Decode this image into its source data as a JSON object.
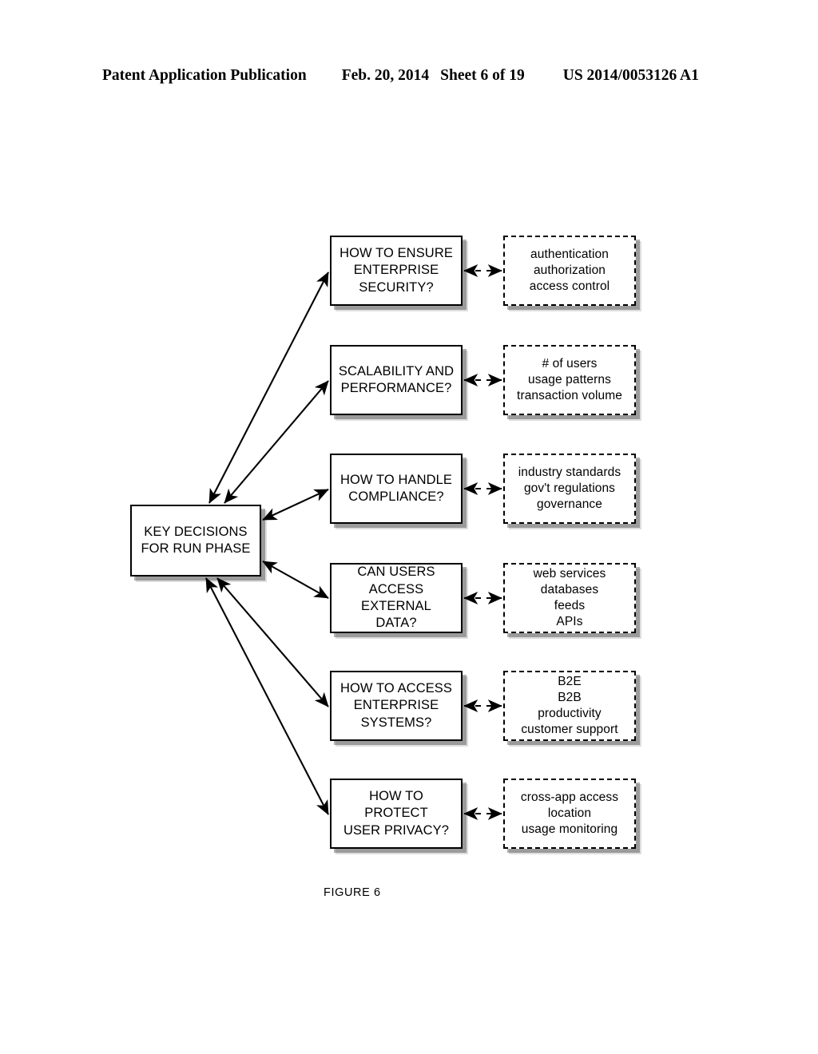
{
  "header": {
    "publication": "Patent Application Publication",
    "date": "Feb. 20, 2014",
    "sheet": "Sheet 6 of 19",
    "number": "US 2014/0053126 A1"
  },
  "figure": {
    "caption": "FIGURE 6",
    "hub": {
      "label": "KEY DECISIONS\nFOR RUN PHASE"
    },
    "rows": [
      {
        "decision": "HOW TO ENSURE\nENTERPRISE\nSECURITY?",
        "attributes": "authentication\nauthorization\naccess control"
      },
      {
        "decision": "SCALABILITY AND\nPERFORMANCE?",
        "attributes": "# of users\nusage patterns\ntransaction volume"
      },
      {
        "decision": "HOW TO HANDLE\nCOMPLIANCE?",
        "attributes": "industry standards\ngov't regulations\ngovernance"
      },
      {
        "decision": "CAN USERS\nACCESS EXTERNAL\nDATA?",
        "attributes": "web services\ndatabases\nfeeds\nAPIs"
      },
      {
        "decision": "HOW TO ACCESS\nENTERPRISE\nSYSTEMS?",
        "attributes": "B2E\nB2B\nproductivity\ncustomer support"
      },
      {
        "decision": "HOW TO PROTECT\nUSER PRIVACY?",
        "attributes": "cross-app access\nlocation\nusage monitoring"
      }
    ]
  },
  "style": {
    "ink": "#000000",
    "paper": "#ffffff"
  }
}
